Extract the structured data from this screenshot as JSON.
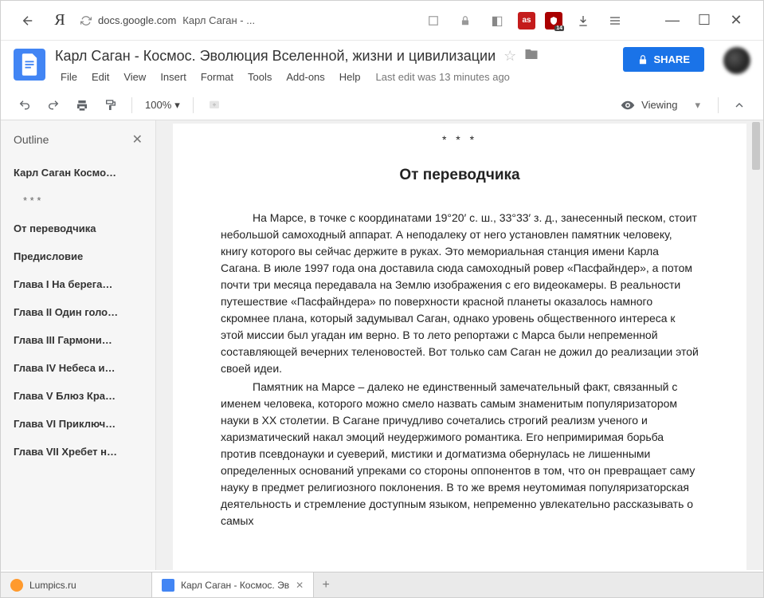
{
  "browser": {
    "host": "docs.google.com",
    "page_title": "Карл Саган - ...",
    "ext_lastfm_label": "as",
    "ublock_badge": "14"
  },
  "window": {
    "minimize": "—",
    "maximize": "☐",
    "close": "✕"
  },
  "header": {
    "doc_title": "Карл Саган - Космос. Эволюция Вселенной, жизни и цивилизации",
    "menu": {
      "file": "File",
      "edit": "Edit",
      "view": "View",
      "insert": "Insert",
      "format": "Format",
      "tools": "Tools",
      "addons": "Add-ons",
      "help": "Help"
    },
    "last_edit": "Last edit was 13 minutes ago",
    "share_label": "SHARE"
  },
  "toolbar": {
    "zoom": "100%",
    "viewing_label": "Viewing"
  },
  "outline": {
    "title": "Outline",
    "items": [
      "Карл Саган Космо…",
      "* * *",
      "От переводчика",
      "Предисловие",
      "Глава I На берега…",
      "Глава II Один голо…",
      "Глава III Гармони…",
      "Глава IV Небеса и…",
      "Глава V Блюз Кра…",
      "Глава VI Приключ…",
      "Глава VII Хребет н…"
    ]
  },
  "document": {
    "separator": "* * *",
    "heading": "От переводчика",
    "para1": "На Марсе, в точке с координатами 19°20′ с. ш., 33°33′ з. д., занесенный песком, стоит небольшой самоходный аппарат. А неподалеку от него установлен памятник человеку, книгу которого вы сейчас держите в руках. Это мемориальная станция имени Карла Сагана. В июле 1997 года она доставила сюда самоходный ровер «Пасфайндер», а потом почти три месяца передавала на Землю изображения с его видеокамеры. В реальности путешествие «Пасфайндера» по поверхности красной планеты оказалось намного скромнее плана, который задумывал Саган, однако уровень общественного интереса к этой миссии был угадан им верно. В то лето репортажи с Марса были непременной составляющей вечерних теленовостей. Вот только сам Саган не дожил до реализации этой своей идеи.",
    "para2": "Памятник на Марсе – далеко не единственный замечательный факт, связанный с именем человека, которого можно смело назвать самым знаменитым популяризатором науки в XX столетии. В Сагане причудливо сочетались строгий реализм ученого и харизматический накал эмоций неудержимого романтика. Его непримиримая борьба против псевдонауки и суеверий, мистики и догматизма обернулась не лишенными определенных оснований упреками со стороны оппонентов в том, что он превращает саму науку в предмет религиозного поклонения. В то же время неутомимая популяризаторская деятельность и стремление доступным языком, непременно увлекательно рассказывать о самых"
  },
  "taskbar": {
    "tabs": [
      {
        "label": "Lumpics.ru",
        "favicon": "orange"
      },
      {
        "label": "Карл Саган - Космос. Эв",
        "favicon": "docs"
      }
    ]
  }
}
